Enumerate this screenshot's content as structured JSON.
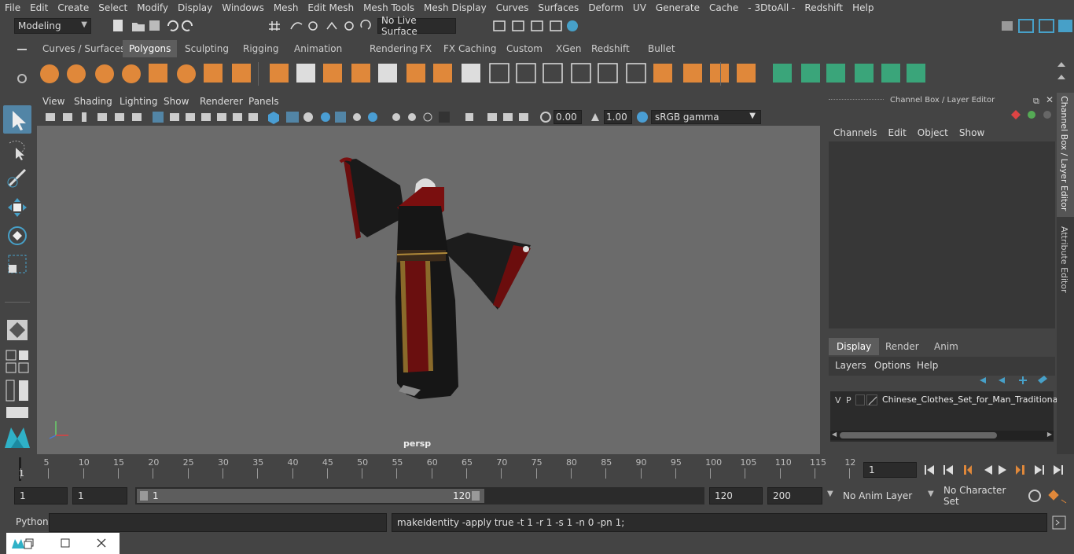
{
  "menubar": [
    "File",
    "Edit",
    "Create",
    "Select",
    "Modify",
    "Display",
    "Windows",
    "Mesh",
    "Edit Mesh",
    "Mesh Tools",
    "Mesh Display",
    "Curves",
    "Surfaces",
    "Deform",
    "UV",
    "Generate",
    "Cache",
    "- 3DtoAll -",
    "Redshift",
    "Help"
  ],
  "status": {
    "mode": "Modeling",
    "live_surface": "No Live Surface"
  },
  "shelf_tabs": [
    "Curves / Surfaces",
    "Polygons",
    "Sculpting",
    "Rigging",
    "Animation",
    "Rendering",
    "FX",
    "FX Caching",
    "Custom",
    "XGen",
    "Redshift",
    "Bullet"
  ],
  "shelf_active": "Polygons",
  "viewport": {
    "menus": [
      "View",
      "Shading",
      "Lighting",
      "Show",
      "Renderer",
      "Panels"
    ],
    "exposure": "0.00",
    "gamma": "1.00",
    "color_space": "sRGB gamma",
    "camera_label": "persp"
  },
  "channel_box": {
    "title": "Channel Box / Layer Editor",
    "menus": [
      "Channels",
      "Edit",
      "Object",
      "Show"
    ],
    "layer_tabs": [
      "Display",
      "Render",
      "Anim"
    ],
    "layer_active": "Display",
    "layer_menus": [
      "Layers",
      "Options",
      "Help"
    ],
    "layer": {
      "v": "V",
      "p": "P",
      "name": "Chinese_Clothes_Set_for_Man_Traditional_S"
    }
  },
  "side_tabs": [
    "Channel Box / Layer Editor",
    "Attribute Editor"
  ],
  "timeline": {
    "labels": [
      "5",
      "10",
      "15",
      "20",
      "25",
      "30",
      "35",
      "40",
      "45",
      "50",
      "55",
      "60",
      "65",
      "70",
      "75",
      "80",
      "85",
      "90",
      "95",
      "100",
      "105",
      "110",
      "115",
      "12"
    ],
    "start_marker": "1",
    "current_frame": "1"
  },
  "range": {
    "start": "1",
    "playback_start": "1",
    "slider_start": "1",
    "slider_end": "120",
    "playback_end": "120",
    "end": "200",
    "anim_layer": "No Anim Layer",
    "character_set": "No Character Set"
  },
  "command": {
    "language": "Python",
    "input": "",
    "result": "makeIdentity -apply true -t 1 -r 1 -s 1 -n 0 -pn 1;"
  },
  "colors": {
    "accent": "#5285a6",
    "shelf_orange": "#e0883a",
    "shelf_green": "#3aa57a"
  }
}
